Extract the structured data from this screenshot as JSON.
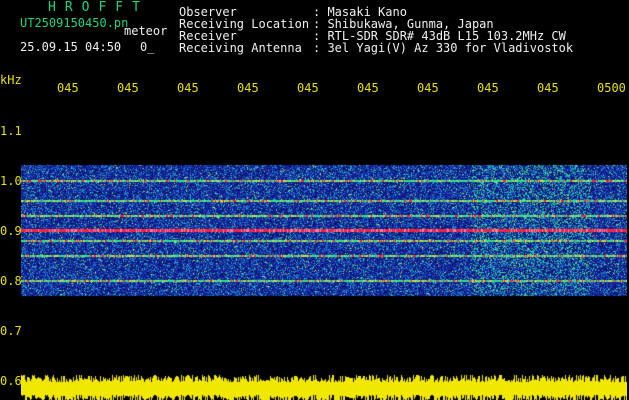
{
  "header": {
    "app_title": "HROFFT",
    "file_name": "UT2509150450.pn",
    "meteor_label": "meteor",
    "date_time": "25.09.15 04:50",
    "count_label": "0_",
    "info_labels": [
      "Observer",
      "Receiving Location",
      "Receiver",
      "Receiving Antenna"
    ],
    "info_values": [
      ": Masaki Kano",
      ": Shibukawa, Gunma, Japan",
      ": RTL-SDR SDR# 43dB L15 103.2MHz CW",
      ": 3el Yagi(V) Az 330 for Vladivostok"
    ]
  },
  "axis": {
    "unit": "kHz",
    "x_ticks": [
      "045",
      "045",
      "045",
      "045",
      "045",
      "045",
      "045",
      "045",
      "045",
      "0500"
    ],
    "y_ticks": [
      "1.1",
      "1.0",
      "0.9",
      "0.8",
      "0.7",
      "0.6"
    ]
  },
  "colors": {
    "background": "#000000",
    "label_yellow": "#e8e000",
    "title_green": "#1fd37a",
    "noise_blue": "#1a2aa8",
    "signal_red": "#ff2040",
    "signal_green": "#30e090",
    "noise_floor_yellow": "#f0e800"
  },
  "chart_data": {
    "type": "heatmap",
    "title": "",
    "xlabel": "",
    "ylabel": "kHz",
    "x_range": [
      "04:50",
      "05:00"
    ],
    "y_range": [
      0.6,
      1.15
    ],
    "band_range": [
      0.77,
      1.03
    ],
    "carrier_lines_khz": [
      1.0,
      0.96,
      0.93,
      0.9,
      0.88,
      0.85,
      0.8
    ],
    "strong_carrier_khz": 0.9
  }
}
